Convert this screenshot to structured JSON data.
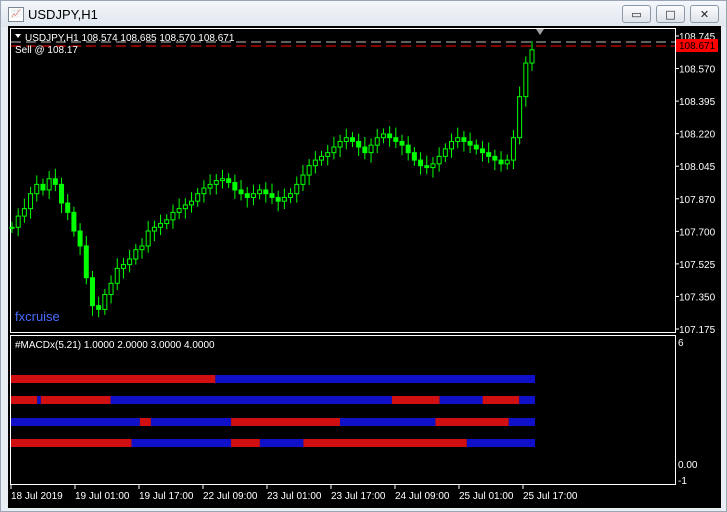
{
  "window": {
    "title": "USDJPY,H1",
    "icon": "chart-window-icon",
    "buttons": {
      "minimize": "▭",
      "maximize": "□",
      "close": "✕"
    }
  },
  "main_chart": {
    "header": "USDJPY,H1  108.574 108.685 108.570 108.671",
    "sell_label": "Sell @ 108.17",
    "watermark": "fxcruise",
    "current_price": "108.671",
    "price_axis": [
      "108.745",
      "108.570",
      "108.395",
      "108.220",
      "108.045",
      "107.870",
      "107.700",
      "107.525",
      "107.350",
      "107.175"
    ],
    "colors": {
      "candle": "#00ff00",
      "bid_line": "#ff0000",
      "ask_line": "#c0c0c0",
      "price_badge": "#ff0000",
      "watermark": "#4a6cff"
    }
  },
  "indicator": {
    "header": "#MACDx(5.21) 1.0000 2.0000 3.0000 4.0000",
    "axis": [
      "6",
      "0.00",
      "-1"
    ],
    "colors": {
      "up": "#1010c8",
      "down": "#d01010"
    },
    "rows": [
      {
        "segments": [
          {
            "from": 0,
            "to": 0.39,
            "state": "down"
          },
          {
            "from": 0.39,
            "to": 1,
            "state": "up"
          }
        ]
      },
      {
        "segments": [
          {
            "from": 0,
            "to": 0.05,
            "state": "down"
          },
          {
            "from": 0.05,
            "to": 0.057,
            "state": "up"
          },
          {
            "from": 0.057,
            "to": 0.19,
            "state": "down"
          },
          {
            "from": 0.19,
            "to": 0.727,
            "state": "up"
          },
          {
            "from": 0.727,
            "to": 0.818,
            "state": "down"
          },
          {
            "from": 0.818,
            "to": 0.9,
            "state": "up"
          },
          {
            "from": 0.9,
            "to": 0.97,
            "state": "down"
          },
          {
            "from": 0.97,
            "to": 1,
            "state": "up"
          }
        ]
      },
      {
        "segments": [
          {
            "from": 0,
            "to": 0.246,
            "state": "up"
          },
          {
            "from": 0.246,
            "to": 0.267,
            "state": "down"
          },
          {
            "from": 0.267,
            "to": 0.42,
            "state": "up"
          },
          {
            "from": 0.42,
            "to": 0.628,
            "state": "down"
          },
          {
            "from": 0.628,
            "to": 0.81,
            "state": "up"
          },
          {
            "from": 0.81,
            "to": 0.95,
            "state": "down"
          },
          {
            "from": 0.95,
            "to": 1,
            "state": "up"
          }
        ]
      },
      {
        "segments": [
          {
            "from": 0,
            "to": 0.23,
            "state": "down"
          },
          {
            "from": 0.23,
            "to": 0.42,
            "state": "up"
          },
          {
            "from": 0.42,
            "to": 0.475,
            "state": "down"
          },
          {
            "from": 0.475,
            "to": 0.558,
            "state": "up"
          },
          {
            "from": 0.558,
            "to": 0.87,
            "state": "down"
          },
          {
            "from": 0.87,
            "to": 1,
            "state": "up"
          }
        ]
      }
    ]
  },
  "time_axis": [
    "18 Jul 2019",
    "19 Jul 01:00",
    "19 Jul 17:00",
    "22 Jul 09:00",
    "23 Jul 01:00",
    "23 Jul 17:00",
    "24 Jul 09:00",
    "25 Jul 01:00",
    "25 Jul 17:00"
  ],
  "chart_data": {
    "type": "candlestick",
    "symbol": "USDJPY",
    "timeframe": "H1",
    "ylim": [
      107.175,
      108.745
    ],
    "close_series": [
      107.72,
      107.78,
      107.82,
      107.9,
      107.95,
      107.92,
      107.98,
      107.95,
      107.85,
      107.8,
      107.7,
      107.62,
      107.45,
      107.3,
      107.28,
      107.36,
      107.42,
      107.5,
      107.52,
      107.55,
      107.6,
      107.62,
      107.7,
      107.72,
      107.74,
      107.76,
      107.8,
      107.82,
      107.84,
      107.86,
      107.9,
      107.93,
      107.95,
      107.97,
      107.98,
      107.96,
      107.92,
      107.9,
      107.88,
      107.9,
      107.92,
      107.9,
      107.88,
      107.86,
      107.88,
      107.9,
      107.95,
      108.0,
      108.05,
      108.08,
      108.1,
      108.12,
      108.15,
      108.18,
      108.2,
      108.18,
      108.15,
      108.12,
      108.16,
      108.2,
      108.22,
      108.2,
      108.18,
      108.16,
      108.12,
      108.08,
      108.05,
      108.04,
      108.06,
      108.1,
      108.14,
      108.18,
      108.2,
      108.18,
      108.16,
      108.14,
      108.12,
      108.1,
      108.08,
      108.06,
      108.08,
      108.2,
      108.42,
      108.6,
      108.671
    ]
  }
}
